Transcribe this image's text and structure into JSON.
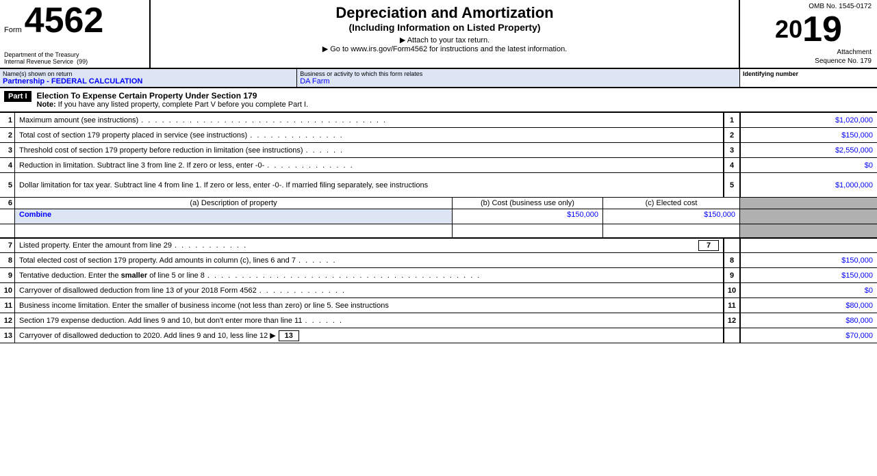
{
  "header": {
    "form_label": "Form",
    "form_number": "4562",
    "dept_line1": "Department of the Treasury",
    "dept_line2": "Internal Revenue Service",
    "code": "(99)",
    "main_title": "Depreciation and Amortization",
    "sub_title": "(Including Information on Listed Property)",
    "attach_text": "▶ Attach to your tax return.",
    "goto_text": "▶ Go to www.irs.gov/Form4562 for instructions and the latest information.",
    "omb": "OMB No. 1545-0172",
    "year_prefix": "20",
    "year_suffix": "19",
    "attachment": "Attachment",
    "sequence": "Sequence No. 179"
  },
  "name_row": {
    "name_label": "Name(s) shown on return",
    "name_value": "Partnership - FEDERAL CALCULATION",
    "activity_label": "Business or activity to which this form relates",
    "activity_value": "DA Farm",
    "id_label": "Identifying number"
  },
  "part1": {
    "badge": "Part I",
    "title": "Election To Expense Certain Property Under Section 179",
    "note_bold": "Note:",
    "note_text": " If you have any listed property, complete Part V before you complete Part I."
  },
  "lines": {
    "l1_num": "1",
    "l1_desc": "Maximum amount (see instructions)",
    "l1_dots": ". . . . . . . . . . . . . . . . . . . . . . . . . . . . . . . . . . . .",
    "l1_ref": "1",
    "l1_val": "$1,020,000",
    "l2_num": "2",
    "l2_desc": "Total cost of section 179 property placed in service (see instructions)",
    "l2_dots": ". . . . . . . . . . . . . .",
    "l2_ref": "2",
    "l2_val": "$150,000",
    "l3_num": "3",
    "l3_desc": "Threshold cost of section 179 property before reduction in limitation (see instructions)",
    "l3_dots": ". . . . . .",
    "l3_ref": "3",
    "l3_val": "$2,550,000",
    "l4_num": "4",
    "l4_desc": "Reduction in limitation. Subtract line 3 from line 2. If zero or less, enter -0-",
    "l4_dots": ". . . . . . . . . . . . .",
    "l4_ref": "4",
    "l4_val": "$0",
    "l5_num": "5",
    "l5_desc": "Dollar limitation for tax year. Subtract line 4 from line 1. If zero or less, enter -0-. If married filing separately, see instructions",
    "l5_dots": ". . . . . . . . . . . . . . . . . . . . . . . . . . . . . . . . . . . . . . . . . . . . . . . . . . . . . . . . . . . . . . . . . . . . . . . . .",
    "l5_ref": "5",
    "l5_val": "$1,000,000",
    "l6_num": "6",
    "l6_col_a": "(a) Description of property",
    "l6_col_b": "(b) Cost (business use only)",
    "l6_col_c": "(c) Elected cost",
    "l6_data_a": "Combine",
    "l6_data_b": "$150,000",
    "l6_data_c": "$150,000",
    "l7_num": "7",
    "l7_desc": "Listed property. Enter the amount from line 29",
    "l7_dots": ". . . . . . . . . . .",
    "l7_ref": "7",
    "l7_val": "",
    "l8_num": "8",
    "l8_desc": "Total elected cost of section 179 property. Add amounts in column (c), lines 6 and 7",
    "l8_dots": ". . . . . .",
    "l8_ref": "8",
    "l8_val": "$150,000",
    "l9_num": "9",
    "l9_desc": "Tentative deduction. Enter the",
    "l9_bold": "smaller",
    "l9_desc2": "of line 5 or line 8",
    "l9_dots": ". . . . . . . . . . . . . . . . . . . . . . . . . . . . . . . . . . . . . . . .",
    "l9_ref": "9",
    "l9_val": "$150,000",
    "l10_num": "10",
    "l10_desc": "Carryover of disallowed deduction from line 13 of your 2018 Form 4562",
    "l10_dots": ". . . . . . . . . . . . .",
    "l10_ref": "10",
    "l10_val": "$0",
    "l11_num": "11",
    "l11_desc": "Business income limitation. Enter the smaller of business income (not less than zero) or line 5. See instructions",
    "l11_ref": "11",
    "l11_val": "$80,000",
    "l12_num": "12",
    "l12_desc": "Section 179 expense deduction. Add lines 9 and 10, but don't enter more than line 11",
    "l12_dots": ". . . . . .",
    "l12_ref": "12",
    "l12_val": "$80,000",
    "l13_num": "13",
    "l13_desc": "Carryover of disallowed deduction to 2020. Add lines 9 and 10, less line 12",
    "l13_arrow": "▶",
    "l13_ref": "13",
    "l13_val": "$70,000"
  }
}
